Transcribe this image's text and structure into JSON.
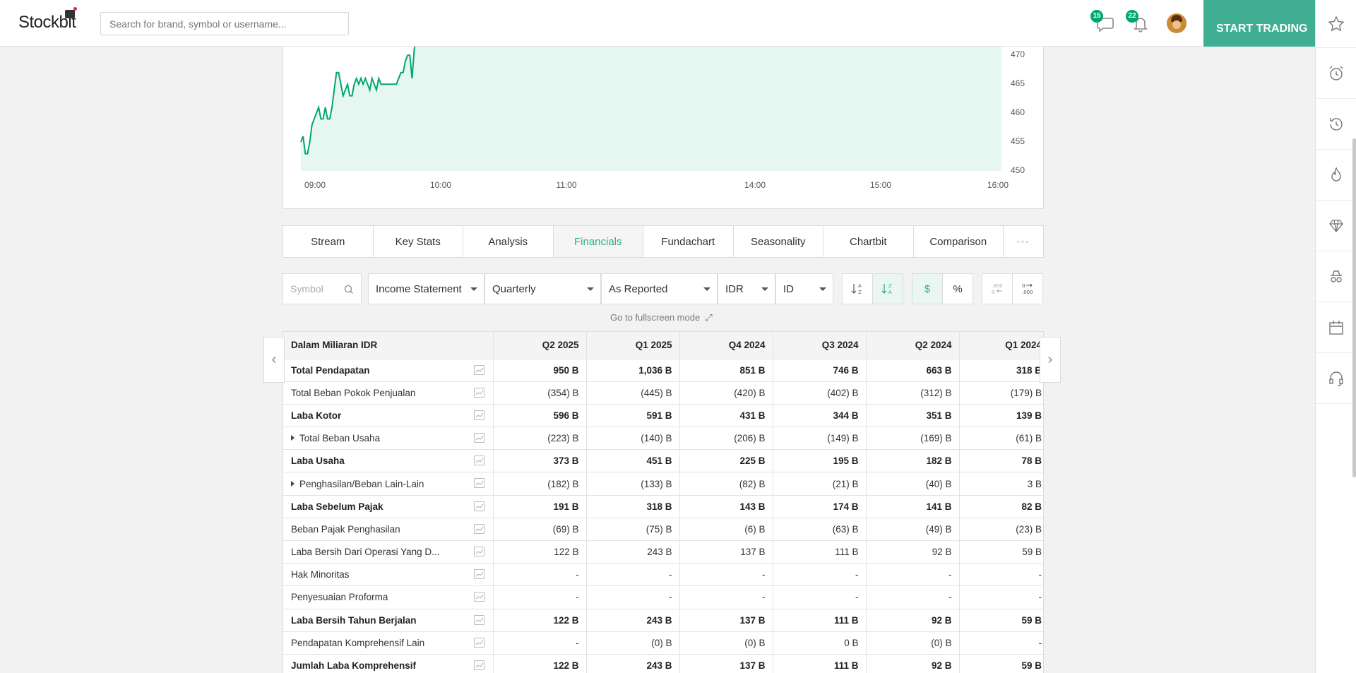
{
  "header": {
    "logo": "Stockbit",
    "search_placeholder": "Search for brand, symbol or username...",
    "messages_count": "15",
    "notifications_count": "22",
    "start_trading": "START TRADING"
  },
  "sidebar_icons": [
    "star-icon",
    "alarm-icon",
    "history-icon",
    "fire-icon",
    "diamond-icon",
    "spy-icon",
    "calendar-icon",
    "headset-icon"
  ],
  "chart": {
    "y_ticks": [
      "470",
      "465",
      "460",
      "455",
      "450"
    ],
    "x_ticks": [
      "09:00",
      "10:00",
      "11:00",
      "14:00",
      "15:00",
      "16:00"
    ],
    "line_color": "#00a86b",
    "fill_color": "#e6f6f0"
  },
  "chart_data": {
    "type": "area",
    "x_ticks": [
      "09:00",
      "10:00",
      "11:00",
      "14:00",
      "15:00",
      "16:00"
    ],
    "ylim": [
      450,
      472
    ],
    "y_ticks": [
      470,
      465,
      460,
      455,
      450
    ],
    "grid": false,
    "series": [
      {
        "values": [
          454,
          455,
          452,
          452,
          454,
          457,
          458,
          459,
          460,
          458,
          458,
          460,
          458,
          458,
          460,
          463,
          466,
          466,
          464,
          462,
          463,
          464,
          462,
          462,
          464,
          465,
          464,
          465,
          464,
          465,
          464,
          463,
          465,
          464,
          463,
          465,
          464,
          464,
          464,
          464,
          464,
          464,
          464,
          464,
          465,
          466,
          466,
          468,
          469,
          469,
          465,
          470,
          472,
          472,
          471
        ]
      }
    ]
  },
  "tabs": [
    {
      "label": "Stream"
    },
    {
      "label": "Key Stats"
    },
    {
      "label": "Analysis"
    },
    {
      "label": "Financials",
      "active": true
    },
    {
      "label": "Fundachart"
    },
    {
      "label": "Seasonality"
    },
    {
      "label": "Chartbit"
    },
    {
      "label": "Comparison"
    },
    {
      "label": "◦◦◦"
    }
  ],
  "controls": {
    "symbol_placeholder": "Symbol",
    "statement": "Income Statement",
    "period": "Quarterly",
    "reporting": "As Reported",
    "currency": "IDR",
    "language": "ID",
    "dollar": "$",
    "percent": "%",
    "fullscreen": "Go to fullscreen mode"
  },
  "table": {
    "header_label": "Dalam Miliaran IDR",
    "columns": [
      "Q2 2025",
      "Q1 2025",
      "Q4 2024",
      "Q3 2024",
      "Q2 2024",
      "Q1 2024"
    ],
    "rows": [
      {
        "label": "Total Pendapatan",
        "bold": true,
        "values": [
          "950 B",
          "1,036 B",
          "851 B",
          "746 B",
          "663 B",
          "318 B"
        ]
      },
      {
        "label": "Total Beban Pokok Penjualan",
        "values": [
          "(354) B",
          "(445) B",
          "(420) B",
          "(402) B",
          "(312) B",
          "(179) B"
        ]
      },
      {
        "label": "Laba Kotor",
        "bold": true,
        "values": [
          "596 B",
          "591 B",
          "431 B",
          "344 B",
          "351 B",
          "139 B"
        ]
      },
      {
        "label": "Total Beban Usaha",
        "expand": true,
        "values": [
          "(223) B",
          "(140) B",
          "(206) B",
          "(149) B",
          "(169) B",
          "(61) B"
        ]
      },
      {
        "label": "Laba Usaha",
        "bold": true,
        "values": [
          "373 B",
          "451 B",
          "225 B",
          "195 B",
          "182 B",
          "78 B"
        ]
      },
      {
        "label": "Penghasilan/Beban Lain-Lain",
        "expand": true,
        "values": [
          "(182) B",
          "(133) B",
          "(82) B",
          "(21) B",
          "(40) B",
          "3 B"
        ]
      },
      {
        "label": "Laba Sebelum Pajak",
        "bold": true,
        "values": [
          "191 B",
          "318 B",
          "143 B",
          "174 B",
          "141 B",
          "82 B"
        ]
      },
      {
        "label": "Beban Pajak Penghasilan",
        "values": [
          "(69) B",
          "(75) B",
          "(6) B",
          "(63) B",
          "(49) B",
          "(23) B"
        ]
      },
      {
        "label": "Laba Bersih Dari Operasi Yang D...",
        "values": [
          "122 B",
          "243 B",
          "137 B",
          "111 B",
          "92 B",
          "59 B"
        ]
      },
      {
        "label": "Hak Minoritas",
        "values": [
          "-",
          "-",
          "-",
          "-",
          "-",
          "-"
        ]
      },
      {
        "label": "Penyesuaian Proforma",
        "values": [
          "-",
          "-",
          "-",
          "-",
          "-",
          "-"
        ]
      },
      {
        "label": "Laba Bersih Tahun Berjalan",
        "bold": true,
        "values": [
          "122 B",
          "243 B",
          "137 B",
          "111 B",
          "92 B",
          "59 B"
        ]
      },
      {
        "label": "Pendapatan Komprehensif Lain",
        "values": [
          "-",
          "(0) B",
          "(0) B",
          "0 B",
          "(0) B",
          "-"
        ]
      },
      {
        "label": "Jumlah Laba Komprehensif",
        "bold": true,
        "values": [
          "122 B",
          "243 B",
          "137 B",
          "111 B",
          "92 B",
          "59 B"
        ]
      }
    ]
  }
}
